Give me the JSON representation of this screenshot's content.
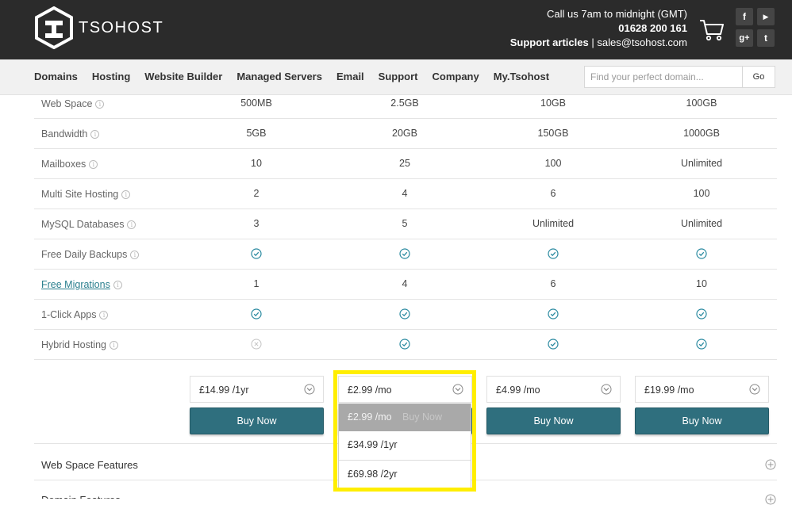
{
  "brand": {
    "name": "TSOHOST"
  },
  "contact": {
    "hours": "Call us 7am to midnight (GMT)",
    "phone": "01628 200 161",
    "support": "Support articles",
    "separator": "|",
    "email": "sales@tsohost.com"
  },
  "social": {
    "facebook": "f",
    "youtube": "▶",
    "googleplus": "g+",
    "twitter": "t"
  },
  "nav": [
    "Domains",
    "Hosting",
    "Website Builder",
    "Managed Servers",
    "Email",
    "Support",
    "Company",
    "My.Tsohost"
  ],
  "search": {
    "placeholder": "Find your perfect domain...",
    "button": "Go"
  },
  "table": {
    "rows": [
      {
        "label": "Web Space",
        "values": [
          "500MB",
          "2.5GB",
          "10GB",
          "100GB"
        ]
      },
      {
        "label": "Bandwidth",
        "values": [
          "5GB",
          "20GB",
          "150GB",
          "1000GB"
        ]
      },
      {
        "label": "Mailboxes",
        "values": [
          "10",
          "25",
          "100",
          "Unlimited"
        ]
      },
      {
        "label": "Multi Site Hosting",
        "values": [
          "2",
          "4",
          "6",
          "100"
        ]
      },
      {
        "label": "MySQL Databases",
        "values": [
          "3",
          "5",
          "Unlimited",
          "Unlimited"
        ]
      },
      {
        "label": "Free Daily Backups",
        "values": [
          "check",
          "check",
          "check",
          "check"
        ]
      },
      {
        "label": "Free Migrations",
        "link": true,
        "values": [
          "1",
          "4",
          "6",
          "10"
        ]
      },
      {
        "label": "1-Click Apps",
        "values": [
          "check",
          "check",
          "check",
          "check"
        ]
      },
      {
        "label": "Hybrid Hosting",
        "values": [
          "cross",
          "check",
          "check",
          "check"
        ]
      }
    ]
  },
  "pricing": {
    "plans": [
      {
        "price": "£14.99 /1yr",
        "buy": "Buy Now"
      },
      {
        "price": "£2.99 /mo",
        "buy": "Buy Now"
      },
      {
        "price": "£4.99 /mo",
        "buy": "Buy Now"
      },
      {
        "price": "£19.99 /mo",
        "buy": "Buy Now"
      }
    ],
    "dropdown": {
      "options": [
        "£2.99 /mo",
        "£34.99 /1yr",
        "£69.98 /2yr"
      ],
      "selected": 0
    }
  },
  "features": [
    "Web Space Features",
    "Domain Features"
  ],
  "colors": {
    "header": "#2b2b2b",
    "buy_button": "#2f6f7e",
    "check": "#2a8aa0",
    "highlight": "#ffee00"
  }
}
